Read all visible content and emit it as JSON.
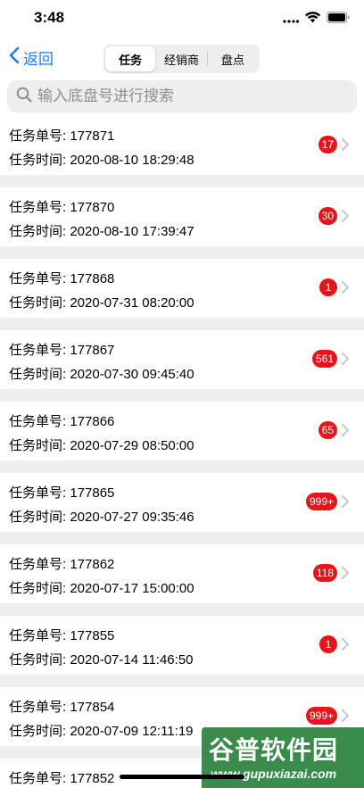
{
  "status": {
    "time": "3:48"
  },
  "nav": {
    "back_label": "返回",
    "segments": [
      "任务",
      "经销商",
      "盘点"
    ]
  },
  "search": {
    "placeholder": "输入底盘号进行搜索"
  },
  "tasks": [
    {
      "label_no": "任务单号: 177871",
      "label_time": "任务时间: 2020-08-10 18:29:48",
      "badge": "17"
    },
    {
      "label_no": "任务单号: 177870",
      "label_time": "任务时间: 2020-08-10 17:39:47",
      "badge": "30"
    },
    {
      "label_no": "任务单号: 177868",
      "label_time": "任务时间: 2020-07-31 08:20:00",
      "badge": "1"
    },
    {
      "label_no": "任务单号: 177867",
      "label_time": "任务时间: 2020-07-30 09:45:40",
      "badge": "561"
    },
    {
      "label_no": "任务单号: 177866",
      "label_time": "任务时间: 2020-07-29 08:50:00",
      "badge": "65"
    },
    {
      "label_no": "任务单号: 177865",
      "label_time": "任务时间: 2020-07-27 09:35:46",
      "badge": "999+"
    },
    {
      "label_no": "任务单号: 177862",
      "label_time": "任务时间: 2020-07-17 15:00:00",
      "badge": "118"
    },
    {
      "label_no": "任务单号: 177855",
      "label_time": "任务时间: 2020-07-14 11:46:50",
      "badge": "1"
    },
    {
      "label_no": "任务单号: 177854",
      "label_time": "任务时间: 2020-07-09 12:11:19",
      "badge": "999+"
    },
    {
      "label_no": "任务单号: 177852",
      "label_time": "",
      "badge": ""
    }
  ],
  "watermark": {
    "title": "谷普软件园",
    "url": "www.gupuxiazai.com"
  },
  "colors": {
    "accent": "#1f7bf2",
    "badge": "#e8141c",
    "separator": "#eeeef0"
  }
}
